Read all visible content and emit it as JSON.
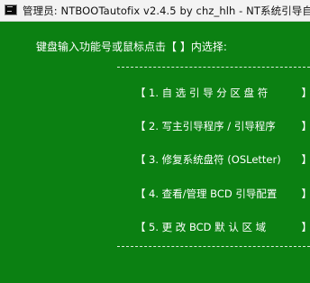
{
  "window": {
    "title": "管理员:  NTBOOTautofix v2.4.5 by chz_hlh - NT系统引导自"
  },
  "console": {
    "prompt": "键盘输入功能号或鼠标点击【 】内选择:",
    "bracket_left": "【",
    "bracket_right": "】",
    "menu": [
      {
        "label": "1. 自 选 引 导 分 区 盘 符"
      },
      {
        "label": "2. 写主引导程序 / 引导程序"
      },
      {
        "label": "3. 修复系统盘符 (OSLetter)"
      },
      {
        "label": "4. 查看/管理 BCD 引导配置"
      },
      {
        "label": "5. 更 改 BCD 默 认 区 域"
      }
    ],
    "colors": {
      "background": "#0b8012",
      "text": "#ffffff"
    }
  }
}
